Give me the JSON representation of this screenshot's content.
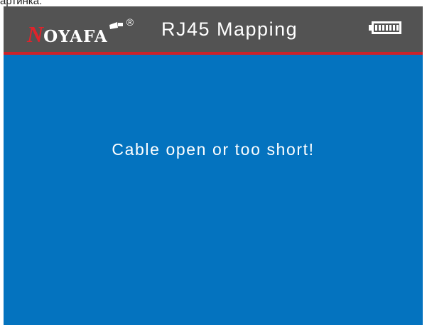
{
  "caption": "артинка:",
  "header": {
    "brand_first_letter": "N",
    "brand_rest": "OYAFA",
    "brand_registered": "®",
    "title": "RJ45 Mapping",
    "battery_icon": "battery-full-icon",
    "battery_level": 1.0
  },
  "main": {
    "message": "Cable open or too short!"
  },
  "colors": {
    "header_bg": "#535353",
    "accent_red": "#cc2229",
    "screen_bg": "#0473bf",
    "text": "#ffffff"
  }
}
